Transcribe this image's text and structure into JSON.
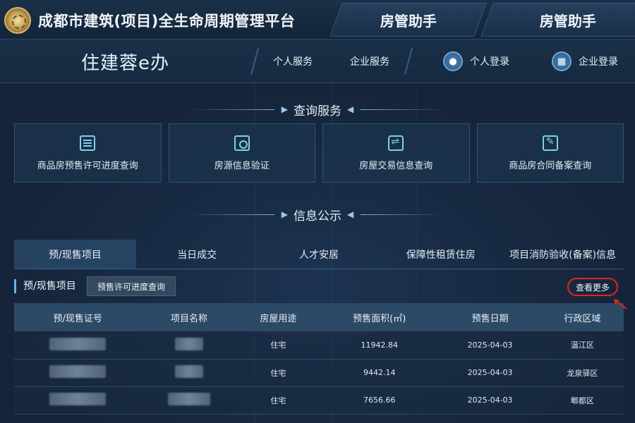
{
  "header": {
    "platform_title": "成都市建筑(项目)全生命周期管理平台",
    "helper_tabs": [
      "房管助手",
      "房管助手"
    ]
  },
  "nav": {
    "sub_title": "住建蓉e办",
    "personal_service": "个人服务",
    "enterprise_service": "企业服务",
    "personal_login": "个人登录",
    "enterprise_login": "企业登录"
  },
  "query_section": {
    "heading": "查询服务",
    "cards": [
      {
        "label": "商品房预售许可进度查询",
        "icon": "document-list-icon"
      },
      {
        "label": "房源信息验证",
        "icon": "search-document-icon"
      },
      {
        "label": "房屋交易信息查询",
        "icon": "house-exchange-icon"
      },
      {
        "label": "商品房合同备案查询",
        "icon": "house-edit-icon"
      }
    ]
  },
  "info_section": {
    "heading": "信息公示",
    "tabs": [
      "预/现售项目",
      "当日成交",
      "人才安居",
      "保障性租赁住房",
      "项目消防验收(备案)信息"
    ],
    "active_tab": 0
  },
  "panel": {
    "title": "预/现售项目",
    "sub_button": "预售许可进度查询",
    "more_link": "查看更多"
  },
  "table": {
    "columns": [
      "预/现售证号",
      "项目名称",
      "房屋用途",
      "预售面积(㎡)",
      "预售日期",
      "行政区域"
    ],
    "rows": [
      {
        "license": "",
        "project": "",
        "usage": "住宅",
        "area": "11942.84",
        "date": "2025-04-03",
        "district": "温江区"
      },
      {
        "license": "",
        "project": "",
        "usage": "住宅",
        "area": "9442.14",
        "date": "2025-04-03",
        "district": "龙泉驿区"
      },
      {
        "license": "",
        "project": "",
        "usage": "住宅",
        "area": "7656.66",
        "date": "2025-04-03",
        "district": "郫都区"
      }
    ]
  },
  "colors": {
    "background": "#15243a",
    "accent": "#7fd0e6",
    "highlight_circle": "#e0261d"
  }
}
